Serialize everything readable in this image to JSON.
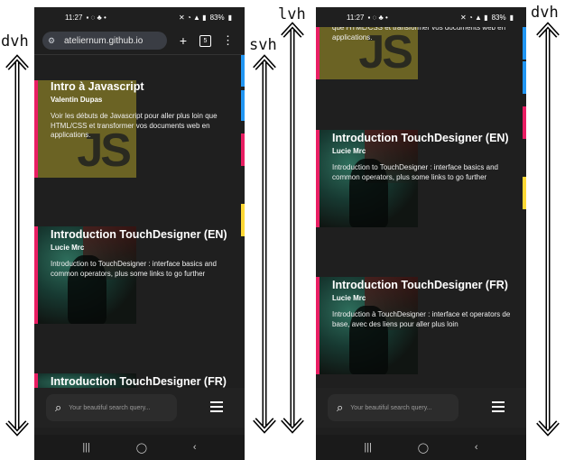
{
  "labels": {
    "dvh": "dvh",
    "svh": "svh",
    "lvh": "lvh"
  },
  "status": {
    "time": "11:27",
    "battery": "83%"
  },
  "browser": {
    "url": "ateliernum.github.io",
    "tab_count": "5"
  },
  "cards": [
    {
      "title": "Intro à Javascript",
      "author": "Valentin Dupas",
      "description": "Voir les débuts de Javascript pour aller plus loin que HTML/CSS et transformer vos documents web en applications.",
      "thumb_text": "JS"
    },
    {
      "title": "Introduction TouchDesigner (EN)",
      "author": "Lucie Mrc",
      "description": "Introduction to TouchDesigner : interface basics and common operators, plus some links to go further"
    },
    {
      "title": "Introduction TouchDesigner (FR)",
      "author": "Lucie Mrc",
      "description": "Introduction à TouchDesigner : interface et operators de base, avec des liens pour aller plus loin"
    }
  ],
  "right_partial_desc": "que HTML/CSS et transformer vos documents web en applications.",
  "search": {
    "placeholder": "Your beautiful search query..."
  },
  "nav": {
    "recents": "|||",
    "home": "◯",
    "back": "‹"
  },
  "colors": {
    "accent_pink": "#e91e63",
    "accent_blue": "#2196f3",
    "accent_yellow": "#fdd835",
    "background": "#1f1f1f"
  }
}
